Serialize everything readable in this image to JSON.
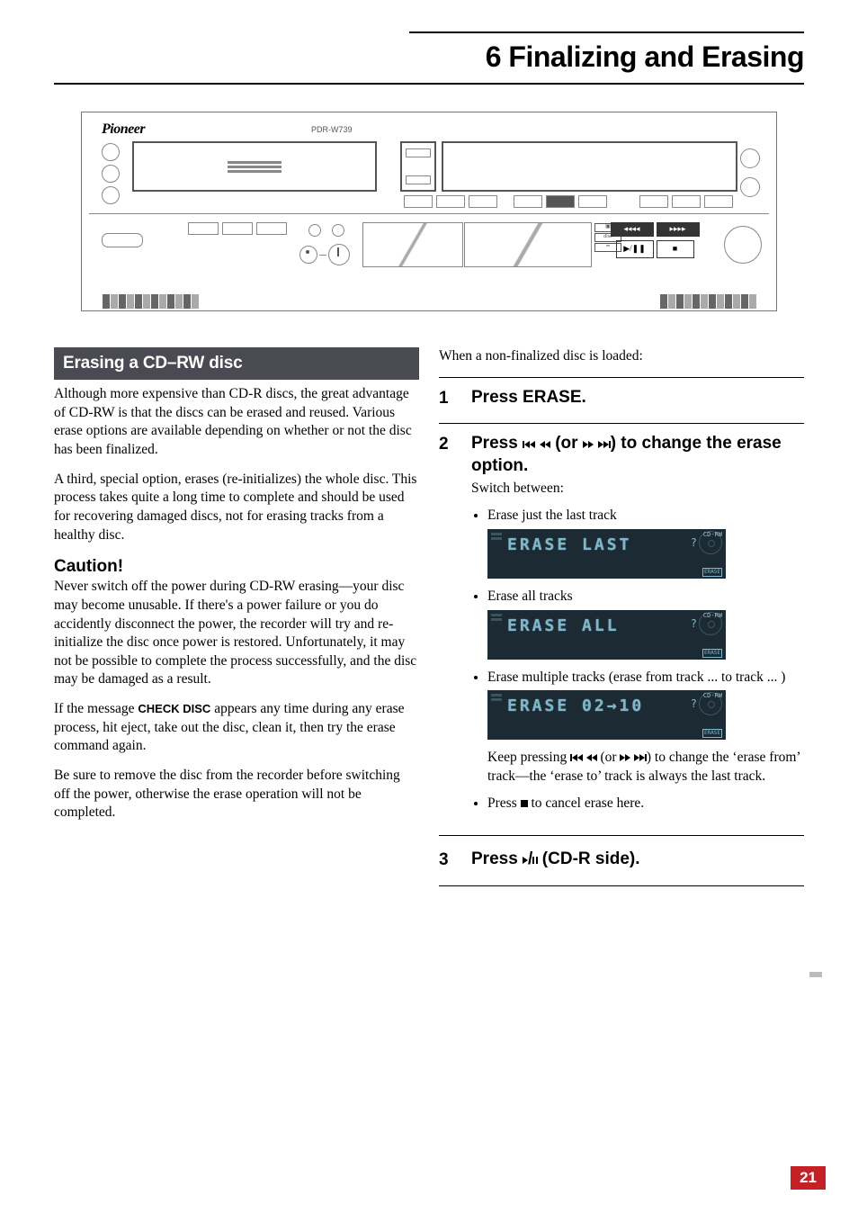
{
  "chapter": {
    "number": "6",
    "title": "Finalizing and Erasing"
  },
  "device": {
    "brand": "Pioneer",
    "model": "PDR-W739"
  },
  "left": {
    "section_head": "Erasing a CD–RW disc",
    "p1": "Although more expensive than CD-R discs, the great advantage of CD-RW is that the discs can be erased and reused. Various erase options are available depending on whether or not the disc has been finalized.",
    "p2": "A third, special option, erases (re-initializes) the whole disc. This process takes quite a long time to complete and should be used for recovering damaged discs, not for erasing tracks from a healthy disc.",
    "caution_head": "Caution!",
    "p3": "Never switch off the power during CD-RW erasing—your disc may become unusable. If there's a power failure or you do accidently disconnect the power, the recorder will try and re-initialize the disc once power is restored. Unfortunately, it may not be possible to complete the process successfully, and the disc may be damaged as a result.",
    "p4a": "If the message ",
    "check_disc": "CHECK DISC",
    "p4b": " appears any time during any erase process, hit eject, take out the disc, clean it, then try the erase command again.",
    "p5": "Be sure to remove the disc from the recorder before switching off the power, otherwise the erase operation will not be completed."
  },
  "right": {
    "intro": "When a non-finalized disc is loaded:",
    "step1": {
      "num": "1",
      "title": "Press ERASE."
    },
    "step2": {
      "num": "2",
      "title_a": "Press ",
      "title_b": " (or ",
      "title_c": ") to change the erase option.",
      "sub": "Switch between:",
      "opt1": "Erase just the last track",
      "lcd1": "ERASE  LAST",
      "opt2": "Erase all tracks",
      "lcd2": "ERASE  ALL",
      "opt3": "Erase multiple tracks (erase from track ... to track ... )",
      "lcd3": "ERASE  02→10",
      "note_a": "Keep pressing ",
      "note_b": " (or ",
      "note_c": ") to change the ‘erase from’ track—the ‘erase to’ track is always the last track.",
      "cancel_a": "Press ",
      "cancel_b": " to cancel erase here."
    },
    "step3": {
      "num": "3",
      "title_a": "Press ",
      "title_b": " (CD-R side)."
    },
    "cdrw_badge": "CD-RW",
    "erase_badge": "ERASE"
  },
  "page_number": "21"
}
